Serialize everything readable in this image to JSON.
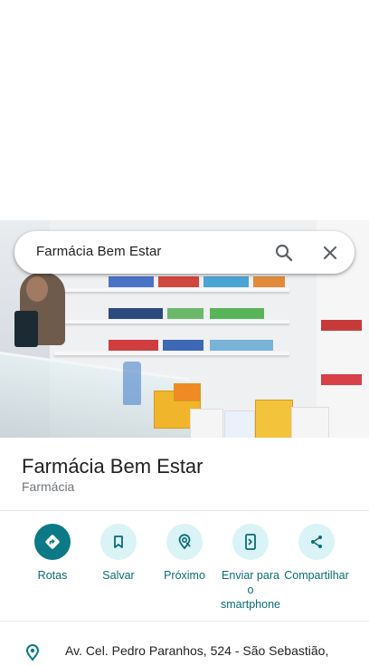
{
  "search": {
    "query": "Farmácia Bem Estar"
  },
  "place": {
    "name": "Farmácia Bem Estar",
    "category": "Farmácia"
  },
  "actions": [
    {
      "label": "Rotas",
      "icon": "directions-icon"
    },
    {
      "label": "Salvar",
      "icon": "bookmark-icon"
    },
    {
      "label": "Próximo",
      "icon": "nearby-icon"
    },
    {
      "label": "Enviar para o smartphone",
      "icon": "send-to-phone-icon"
    },
    {
      "label": "Compartilhar",
      "icon": "share-icon"
    }
  ],
  "address": {
    "text": "Av. Cel. Pedro Paranhos, 524 - São Sebastião,"
  },
  "colors": {
    "accent": "#0b7a86",
    "accent_light": "#d9f3f7",
    "label": "#0b6b76"
  }
}
